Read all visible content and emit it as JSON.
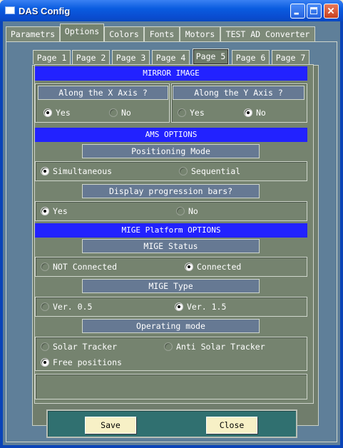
{
  "window": {
    "title": "DAS Config"
  },
  "outer_tabs": [
    "Parametrs",
    "Options",
    "Colors",
    "Fonts",
    "Motors",
    "TEST AD Converter"
  ],
  "inner_tabs": [
    "Page 1",
    "Page 2",
    "Page 3",
    "Page 4",
    "Page 5",
    "Page 6",
    "Page 7"
  ],
  "mirror": {
    "header": "MIRROR IMAGE",
    "x_axis_label": "Along the X Axis ?",
    "y_axis_label": "Along the Y Axis ?",
    "x_yes": "Yes",
    "x_no": "No",
    "y_yes": "Yes",
    "y_no": "No"
  },
  "ams": {
    "header": "AMS OPTIONS",
    "positioning_label": "Positioning Mode",
    "simultaneous": "Simultaneous",
    "sequential": "Sequential",
    "progress_label": "Display progression bars?",
    "yes": "Yes",
    "no": "No"
  },
  "mige": {
    "header": "MIGE Platform OPTIONS",
    "status_label": "MIGE Status",
    "not_connected": "NOT Connected",
    "connected": "Connected",
    "type_label": "MIGE Type",
    "ver05": "Ver. 0.5",
    "ver15": "Ver. 1.5",
    "mode_label": "Operating mode",
    "solar": "Solar Tracker",
    "anti_solar": "Anti Solar Tracker",
    "free": "Free positions"
  },
  "buttons": {
    "save": "Save",
    "close": "Close"
  }
}
